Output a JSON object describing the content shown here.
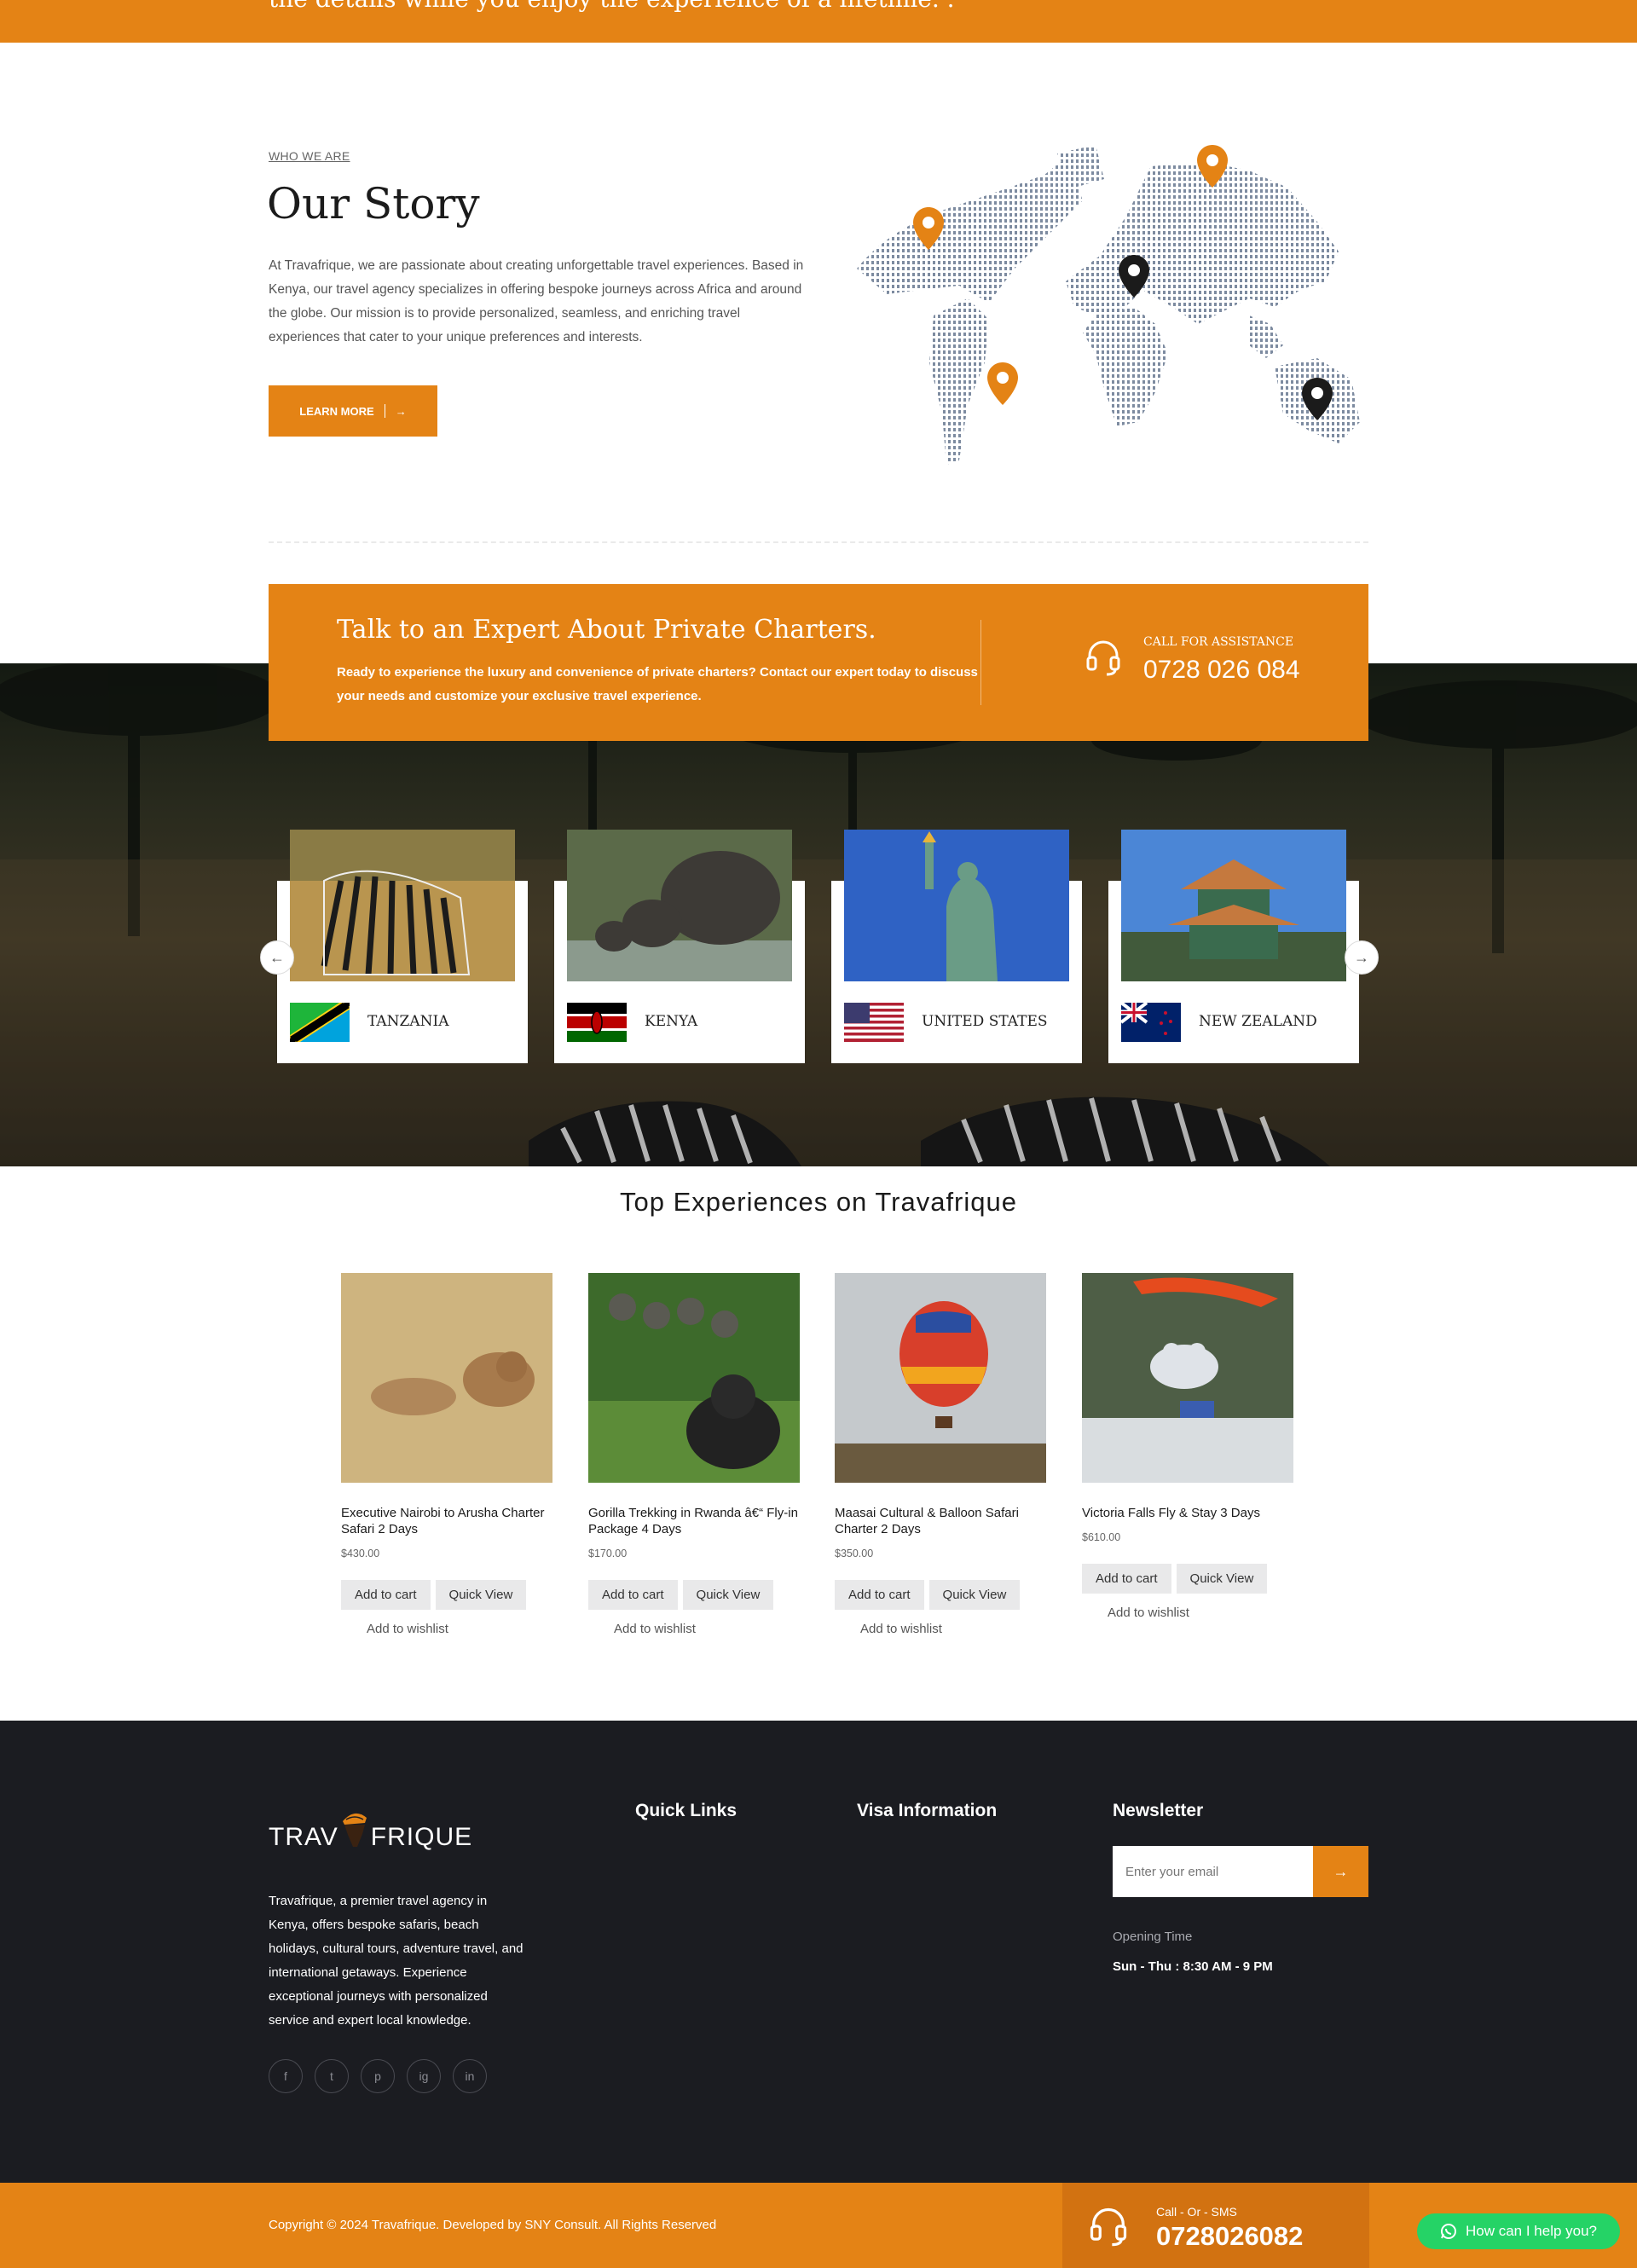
{
  "top_strip": {
    "text": "the details while you enjoy the experience of a lifetime. ."
  },
  "story": {
    "eyebrow": "WHO WE ARE",
    "title": "Our Story",
    "body": "At Travafrique, we are passionate about creating unforgettable travel experiences. Based in Kenya, our travel agency specializes in offering bespoke journeys across Africa and around the globe. Our mission is to provide personalized, seamless, and enriching travel experiences that cater to your unique preferences and interests.",
    "button_label": "LEARN MORE",
    "map_icon": "world-map-with-pins"
  },
  "expert_banner": {
    "title": "Talk to an Expert About Private Charters.",
    "text": "Ready to experience the luxury and convenience of private charters? Contact our expert today to discuss your needs and customize your exclusive travel experience.",
    "call_label": "CALL FOR ASSISTANCE",
    "call_number": "0728 026 084",
    "icon": "headset-icon"
  },
  "destinations": [
    {
      "name": "TANZANIA",
      "image": "zebras",
      "flag": "tanzania-flag"
    },
    {
      "name": "KENYA",
      "image": "elephants",
      "flag": "kenya-flag"
    },
    {
      "name": "UNITED STATES",
      "image": "statue-of-liberty",
      "flag": "us-flag"
    },
    {
      "name": "NEW ZEALAND",
      "image": "pagoda",
      "flag": "new-zealand-flag"
    }
  ],
  "experiences": {
    "title": "Top Experiences on Travafrique",
    "products": [
      {
        "name": "Executive Nairobi to Arusha Charter Safari 2 Days",
        "price": "$430.00",
        "add_to_cart": "Add to cart",
        "quick_view": "Quick View",
        "wishlist": "Add to wishlist"
      },
      {
        "name": "Gorilla Trekking in Rwanda â€“ Fly-in Package 4 Days",
        "price": "$170.00",
        "add_to_cart": "Add to cart",
        "quick_view": "Quick View",
        "wishlist": "Add to wishlist"
      },
      {
        "name": "Maasai Cultural & Balloon Safari Charter 2 Days",
        "price": "$350.00",
        "add_to_cart": "Add to cart",
        "quick_view": "Quick View",
        "wishlist": "Add to wishlist"
      },
      {
        "name": "Victoria Falls Fly & Stay 3 Days",
        "price": "$610.00",
        "add_to_cart": "Add to cart",
        "quick_view": "Quick View",
        "wishlist": "Add to wishlist"
      }
    ]
  },
  "footer": {
    "logo_left": "TRAV",
    "logo_right": "FRIQUE",
    "about": "Travafrique, a premier travel agency in Kenya, offers bespoke safaris, beach holidays, cultural tours, adventure travel, and international getaways. Experience exceptional journeys with personalized service and expert local knowledge.",
    "social": [
      "f",
      "t",
      "p",
      "ig",
      "in"
    ],
    "quick_links_heading": "Quick Links",
    "visa_heading": "Visa Information",
    "newsletter_heading": "Newsletter",
    "newsletter_placeholder": "Enter your email",
    "opening_label": "Opening Time",
    "opening_hours": "Sun - Thu : 8:30 AM - 9 PM"
  },
  "bottom_bar": {
    "copyright": "Copyright © 2024 Travafrique. Developed by SNY Consult. All Rights Reserved",
    "call_sms_label": "Call - Or - SMS",
    "call_sms_number": "0728026082",
    "whatsapp_label": "How can I help you?"
  },
  "colors": {
    "accent": "#e48315",
    "footer_bg": "#1b1c21",
    "whatsapp": "#25d366"
  }
}
